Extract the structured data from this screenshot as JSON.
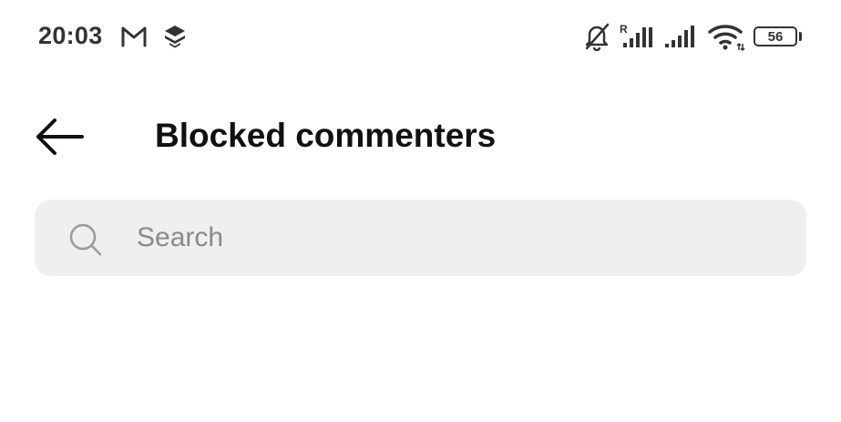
{
  "status_bar": {
    "time": "20:03",
    "battery_level": "56",
    "left_icons": [
      "gmail-icon",
      "layers-app-icon"
    ],
    "right_icons": [
      "bell-muted-icon",
      "signal-roaming-icon",
      "signal-icon",
      "wifi-icon",
      "battery-icon"
    ]
  },
  "header": {
    "back_icon": "arrow-left-icon",
    "title": "Blocked commenters"
  },
  "search": {
    "icon": "search-icon",
    "placeholder": "Search",
    "value": ""
  },
  "colors": {
    "background": "#ffffff",
    "search_field": "#efefef",
    "text_primary": "#111111",
    "placeholder": "#8a8a8a",
    "status_icons": "#333333"
  }
}
